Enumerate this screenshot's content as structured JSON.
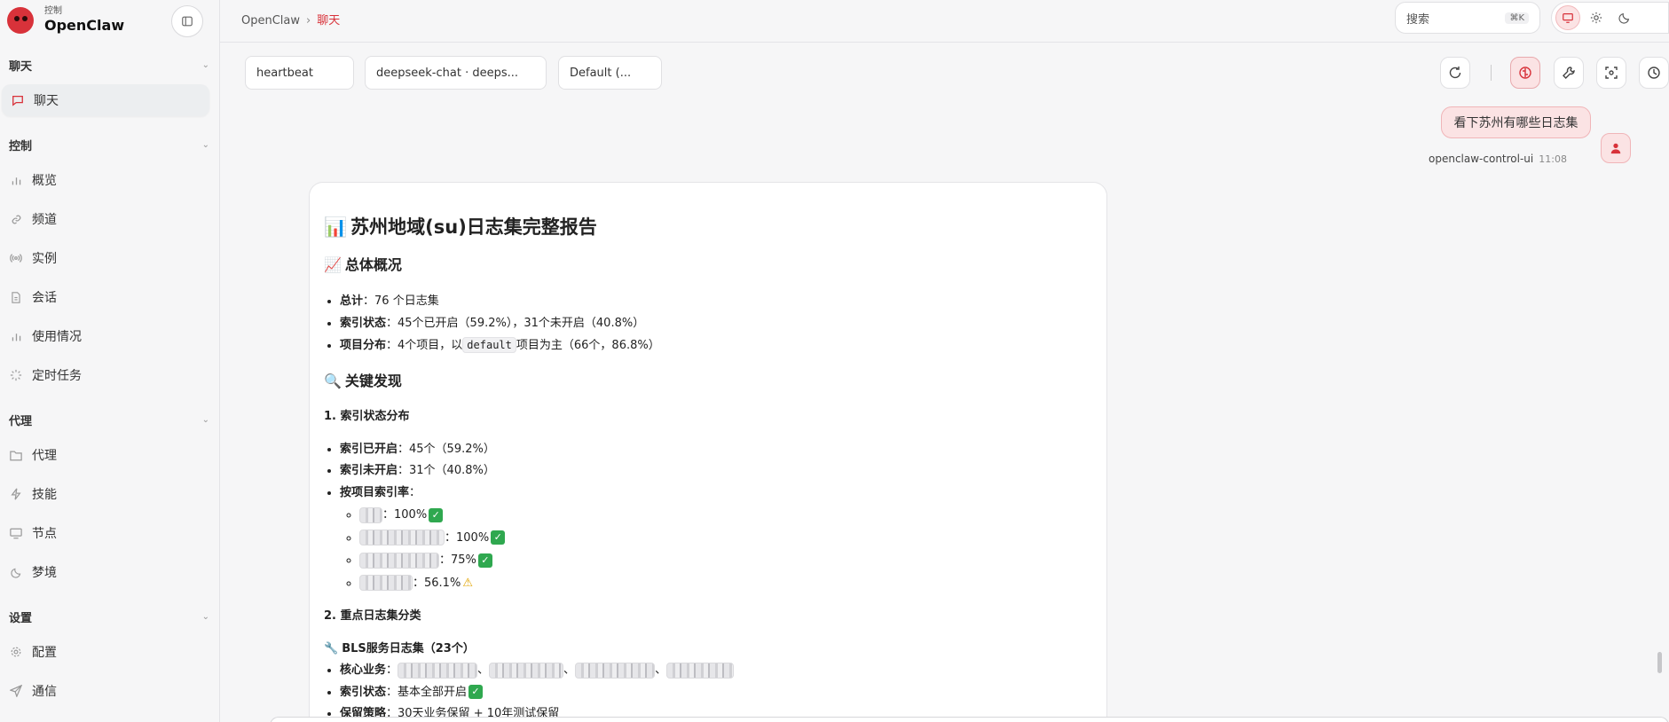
{
  "brand": {
    "small": "控制",
    "title": "OpenClaw"
  },
  "sidebar": {
    "sections": [
      {
        "label": "聊天",
        "items": [
          {
            "label": "聊天",
            "icon": "chat-bubble-icon",
            "active": true
          }
        ]
      },
      {
        "label": "控制",
        "items": [
          {
            "label": "概览",
            "icon": "bar-chart-icon"
          },
          {
            "label": "频道",
            "icon": "link-icon"
          },
          {
            "label": "实例",
            "icon": "broadcast-icon"
          },
          {
            "label": "会话",
            "icon": "document-icon"
          },
          {
            "label": "使用情况",
            "icon": "bar-chart-icon"
          },
          {
            "label": "定时任务",
            "icon": "loader-icon"
          }
        ]
      },
      {
        "label": "代理",
        "items": [
          {
            "label": "代理",
            "icon": "folder-icon"
          },
          {
            "label": "技能",
            "icon": "lightning-icon"
          },
          {
            "label": "节点",
            "icon": "monitor-icon"
          },
          {
            "label": "梦境",
            "icon": "moon-icon"
          }
        ]
      },
      {
        "label": "设置",
        "items": [
          {
            "label": "配置",
            "icon": "gear-icon"
          },
          {
            "label": "通信",
            "icon": "send-icon"
          }
        ]
      }
    ]
  },
  "topbar": {
    "breadcrumb": [
      "OpenClaw",
      "聊天"
    ],
    "search": {
      "placeholder": "搜索",
      "shortcut": "⌘K"
    }
  },
  "toolbar": {
    "session": "heartbeat",
    "model": "deepseek-chat · deeps...",
    "profile": "Default (..."
  },
  "user_message": {
    "text": "看下苏州有哪些日志集",
    "sender": "openclaw-control-ui",
    "time": "11:08"
  },
  "report": {
    "title_emoji": "📊",
    "title": "苏州地域(su)日志集完整报告",
    "overview_emoji": "📈",
    "overview_title": "总体概况",
    "overview": [
      {
        "label": "总计",
        "text": "：76 个日志集"
      },
      {
        "label": "索引状态",
        "text": "：45个已开启（59.2%），31个未开启（40.8%）"
      },
      {
        "label": "项目分布",
        "text_before": "：4个项目，以",
        "code": "default",
        "text_after": "项目为主（66个，86.8%）"
      }
    ],
    "findings_emoji": "🔍",
    "findings_title": "关键发现",
    "sub1": "1. 索引状态分布",
    "index_items": [
      {
        "label": "索引已开启",
        "text": "：45个（59.2%）"
      },
      {
        "label": "索引未开启",
        "text": "：31个（40.8%）"
      },
      {
        "label": "按项目索引率",
        "text": "："
      }
    ],
    "project_rates": [
      {
        "value": "：100%",
        "mark": "check"
      },
      {
        "value": "：100%",
        "mark": "check"
      },
      {
        "value": "：75%",
        "mark": "check"
      },
      {
        "value": "：56.1%",
        "mark": "warn"
      }
    ],
    "sub2": "2. 重点日志集分类",
    "bls_emoji": "🔧",
    "bls_title": "BLS服务日志集（23个）",
    "bls_items": [
      {
        "label": "核心业务",
        "text": "："
      },
      {
        "label": "索引状态",
        "text": "：基本全部开启"
      },
      {
        "label": "保留策略",
        "text": "：30天业务保留 + 10年测试保留"
      }
    ]
  }
}
